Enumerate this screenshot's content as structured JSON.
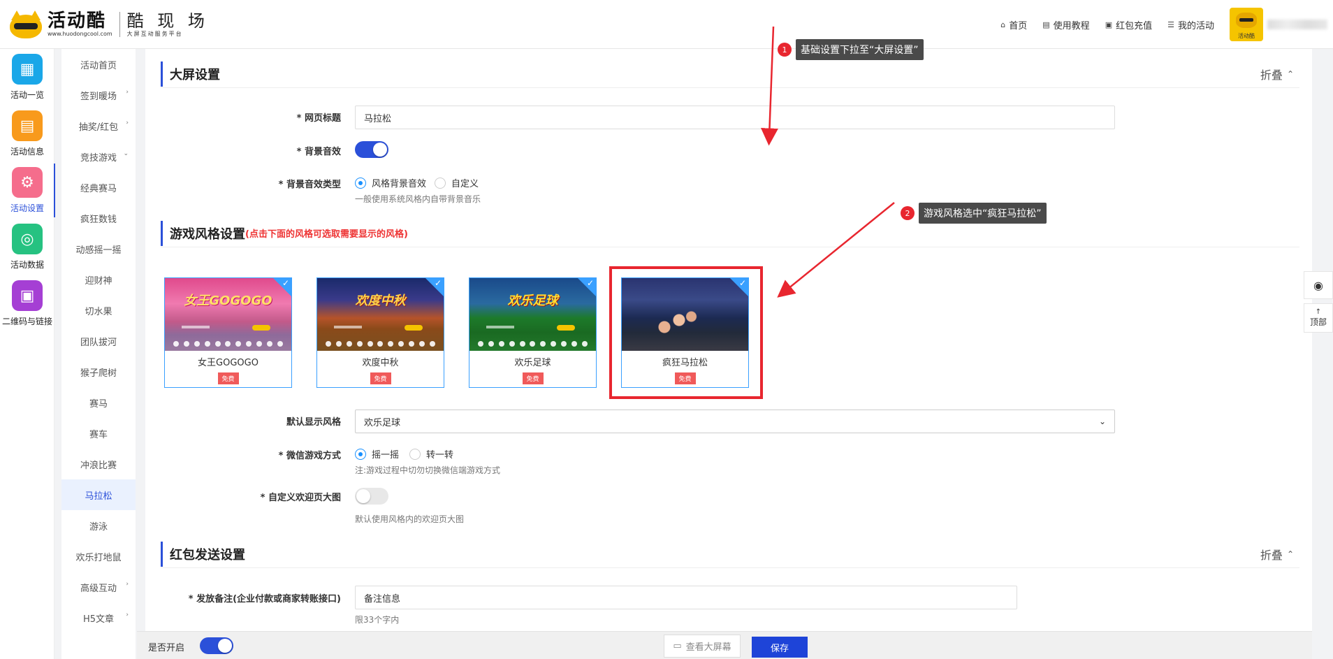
{
  "header": {
    "logo_text": "活动酷",
    "logo_url": "www.huodongcool.com",
    "logo_brand": "酷 现 场",
    "logo_tagline": "大屏互动服务平台",
    "nav": [
      {
        "icon": "home-icon",
        "label": "首页"
      },
      {
        "icon": "book-icon",
        "label": "使用教程"
      },
      {
        "icon": "wallet-icon",
        "label": "红包充值"
      },
      {
        "icon": "list-icon",
        "label": "我的活动"
      }
    ],
    "avatar_text": "活动酷"
  },
  "iconbar": [
    {
      "label": "活动一览",
      "icon": "grid-icon",
      "color": "#1aa7e8"
    },
    {
      "label": "活动信息",
      "icon": "document-icon",
      "color": "#f89a1c"
    },
    {
      "label": "活动设置",
      "icon": "gear-icon",
      "color": "#f56d8c"
    },
    {
      "label": "活动数据",
      "icon": "database-icon",
      "color": "#26c281"
    },
    {
      "label": "二维码与链接",
      "icon": "qrcode-icon",
      "color": "#a53fd4"
    }
  ],
  "submenu": [
    {
      "label": "活动首页",
      "arrow": ""
    },
    {
      "label": "签到暖场",
      "arrow": "›"
    },
    {
      "label": "抽奖/红包",
      "arrow": "›"
    },
    {
      "label": "竞技游戏",
      "arrow": "⌄"
    },
    {
      "label": "经典赛马",
      "arrow": ""
    },
    {
      "label": "疯狂数钱",
      "arrow": ""
    },
    {
      "label": "动感摇一摇",
      "arrow": ""
    },
    {
      "label": "迎财神",
      "arrow": ""
    },
    {
      "label": "切水果",
      "arrow": ""
    },
    {
      "label": "团队拔河",
      "arrow": ""
    },
    {
      "label": "猴子爬树",
      "arrow": ""
    },
    {
      "label": "赛马",
      "arrow": ""
    },
    {
      "label": "赛车",
      "arrow": ""
    },
    {
      "label": "冲浪比赛",
      "arrow": ""
    },
    {
      "label": "马拉松",
      "arrow": "",
      "active": true
    },
    {
      "label": "游泳",
      "arrow": ""
    },
    {
      "label": "欢乐打地鼠",
      "arrow": ""
    },
    {
      "label": "高级互动",
      "arrow": "›"
    },
    {
      "label": "H5文章",
      "arrow": "›"
    }
  ],
  "screen": {
    "title": "大屏设置",
    "fold_label": "折叠",
    "page_title_label": "* 网页标题",
    "page_title_value": "马拉松",
    "bg_sound_label": "* 背景音效",
    "bg_sound_on": true,
    "bg_sound_type_label": "* 背景音效类型",
    "bg_sound_type_options": [
      "风格背景音效",
      "自定义"
    ],
    "bg_sound_type_selected": "风格背景音效",
    "bg_sound_type_tip": "一般使用系统风格内自带背景音乐"
  },
  "style": {
    "title": "游戏风格设置",
    "hint": "(点击下面的风格可选取需要显示的风格)",
    "cards": [
      {
        "name": "女王GOGOGO",
        "badge": "免费",
        "theme": "pink",
        "banner": "女王GOGOGO"
      },
      {
        "name": "欢度中秋",
        "badge": "免费",
        "theme": "autumn",
        "banner": "欢度中秋"
      },
      {
        "name": "欢乐足球",
        "badge": "免费",
        "theme": "soccer",
        "banner": "欢乐足球"
      },
      {
        "name": "疯狂马拉松",
        "badge": "免费",
        "theme": "marathon",
        "banner": ""
      }
    ],
    "default_style_label": "默认显示风格",
    "default_style_value": "欢乐足球",
    "wechat_mode_label": "* 微信游戏方式",
    "wechat_mode_options": [
      "摇一摇",
      "转一转"
    ],
    "wechat_mode_selected": "摇一摇",
    "wechat_mode_tip": "注:游戏过程中切勿切换微信端游戏方式",
    "welcome_label": "* 自定义欢迎页大图",
    "welcome_on": false,
    "welcome_tip": "默认使用风格内的欢迎页大图"
  },
  "redpacket": {
    "title": "红包发送设置",
    "fold_label": "折叠",
    "remark_label": "* 发放备注(企业付款或商家转账接口)",
    "remark_placeholder": "备注信息",
    "remark_tip": "限33个字内"
  },
  "annotations": [
    {
      "num": "1",
      "text": "基础设置下拉至“大屏设置”"
    },
    {
      "num": "2",
      "text": "游戏风格选中“疯狂马拉松”"
    }
  ],
  "footer": {
    "open_label": "是否开启",
    "open_on": true,
    "preview_label": "查看大屏幕",
    "save_label": "保存"
  },
  "floating": {
    "qq_icon": "qq-icon",
    "top_label": "顶部"
  },
  "colors": {
    "primary": "#2b50d9",
    "annotation_red": "#e8262f",
    "card_border": "#3aa0ff",
    "free_badge": "#f05a5a"
  }
}
